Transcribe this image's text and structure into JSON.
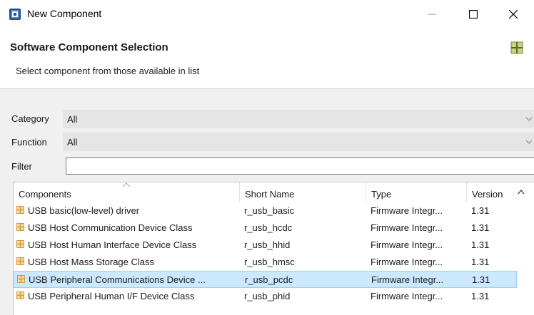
{
  "window": {
    "title": "New Component",
    "app_icon": "component-wizard-icon",
    "controls": {
      "minimize": "minimize-icon",
      "maximize": "maximize-icon",
      "close": "close-icon"
    }
  },
  "header": {
    "title": "Software Component Selection",
    "subtitle": "Select component from those available in list",
    "icon": "component-grid-icon"
  },
  "filters": {
    "category_label": "Category",
    "category_value": "All",
    "function_label": "Function",
    "function_value": "All",
    "filter_label": "Filter",
    "filter_value": ""
  },
  "table": {
    "columns": [
      "Components",
      "Short Name",
      "Type",
      "Version"
    ],
    "rows": [
      {
        "component": "USB basic(low-level) driver",
        "short_name": "r_usb_basic",
        "type": "Firmware Integr...",
        "version": "1.31",
        "selected": false
      },
      {
        "component": "USB Host Communication Device Class",
        "short_name": "r_usb_hcdc",
        "type": "Firmware Integr...",
        "version": "1.31",
        "selected": false
      },
      {
        "component": "USB Host Human Interface Device Class",
        "short_name": "r_usb_hhid",
        "type": "Firmware Integr...",
        "version": "1.31",
        "selected": false
      },
      {
        "component": "USB Host Mass Storage Class",
        "short_name": "r_usb_hmsc",
        "type": "Firmware Integr...",
        "version": "1.31",
        "selected": false
      },
      {
        "component": "USB Peripheral Communications Device ...",
        "short_name": "r_usb_pcdc",
        "type": "Firmware Integr...",
        "version": "1.31",
        "selected": true
      },
      {
        "component": "USB Peripheral Human I/F Device Class",
        "short_name": "r_usb_phid",
        "type": "Firmware Integr...",
        "version": "1.31",
        "selected": false
      }
    ]
  },
  "colors": {
    "selection_bg": "#cce8ff",
    "selection_border": "#99d1ff",
    "component_icon": "#d49a3a",
    "header_icon": "#8a9a2a"
  }
}
